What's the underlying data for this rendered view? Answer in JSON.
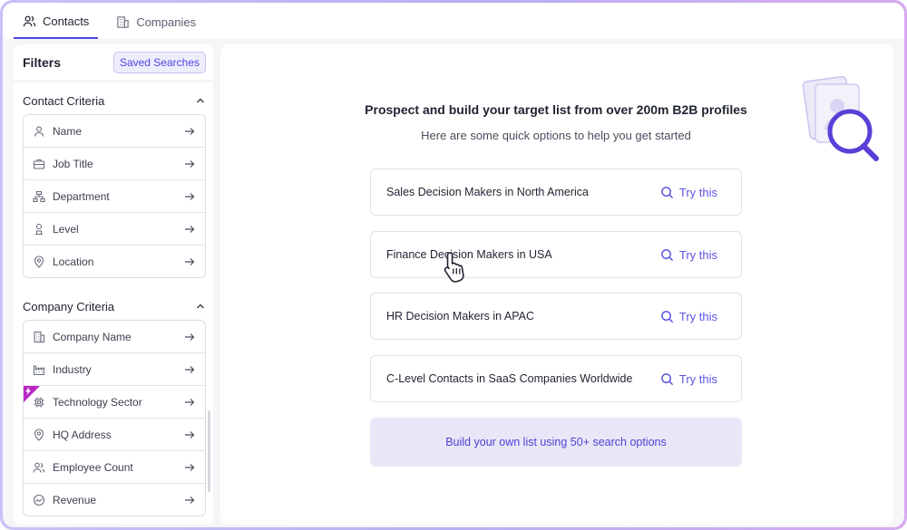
{
  "tabs": [
    {
      "label": "Contacts",
      "icon": "contacts-icon",
      "active": true
    },
    {
      "label": "Companies",
      "icon": "building-icon",
      "active": false
    }
  ],
  "sidebar": {
    "title": "Filters",
    "saved_searches_label": "Saved Searches",
    "contact_criteria": {
      "title": "Contact Criteria",
      "items": [
        {
          "label": "Name",
          "icon": "person-icon"
        },
        {
          "label": "Job Title",
          "icon": "briefcase-icon"
        },
        {
          "label": "Department",
          "icon": "org-chart-icon"
        },
        {
          "label": "Level",
          "icon": "level-icon"
        },
        {
          "label": "Location",
          "icon": "location-pin-icon"
        }
      ]
    },
    "company_criteria": {
      "title": "Company Criteria",
      "items": [
        {
          "label": "Company Name",
          "icon": "building-icon"
        },
        {
          "label": "Industry",
          "icon": "factory-icon"
        },
        {
          "label": "Technology Sector",
          "icon": "chip-icon"
        },
        {
          "label": "HQ Address",
          "icon": "location-pin-icon"
        },
        {
          "label": "Employee Count",
          "icon": "people-icon"
        },
        {
          "label": "Revenue",
          "icon": "revenue-icon"
        }
      ]
    }
  },
  "main": {
    "headline": "Prospect and build your target list from over 200m B2B profiles",
    "subline": "Here are some quick options to help you get started",
    "options": [
      {
        "label": "Sales Decision Makers in North America",
        "action": "Try this"
      },
      {
        "label": "Finance Decision Makers in USA",
        "action": "Try this"
      },
      {
        "label": "HR Decision Makers in APAC",
        "action": "Try this"
      },
      {
        "label": "C-Level Contacts in SaaS Companies Worldwide",
        "action": "Try this"
      }
    ],
    "build_own_label": "Build your own list using 50+ search options"
  },
  "colors": {
    "accent": "#4f46e5",
    "badge": "#b925c4",
    "build_bg": "#e9e7f7"
  }
}
